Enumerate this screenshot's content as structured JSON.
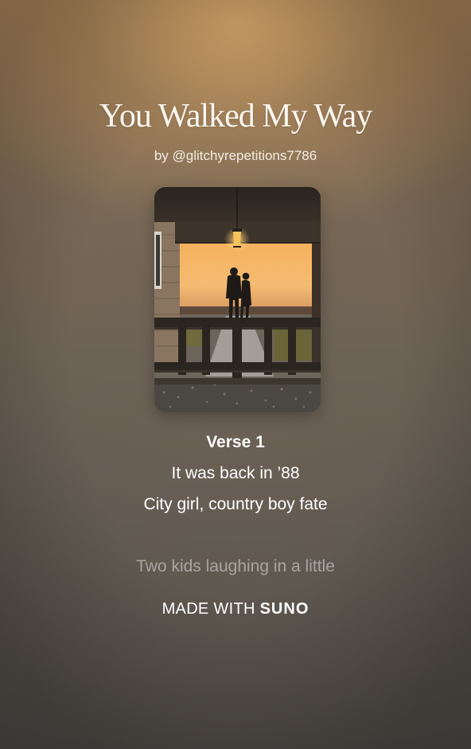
{
  "song": {
    "title": "You Walked My Way",
    "byline": "by @glitchyrepetitions7786"
  },
  "lyrics": {
    "section": "Verse 1",
    "lines": [
      "It was back in ’88",
      "City girl, country boy fate"
    ],
    "upcoming_line": "Two kids laughing in a little"
  },
  "footer": {
    "made_with": "MADE WITH",
    "brand": "SUNO"
  },
  "colors": {
    "background_top": "#a27f58",
    "background_bottom": "#4a4744",
    "text": "#ffffff"
  }
}
